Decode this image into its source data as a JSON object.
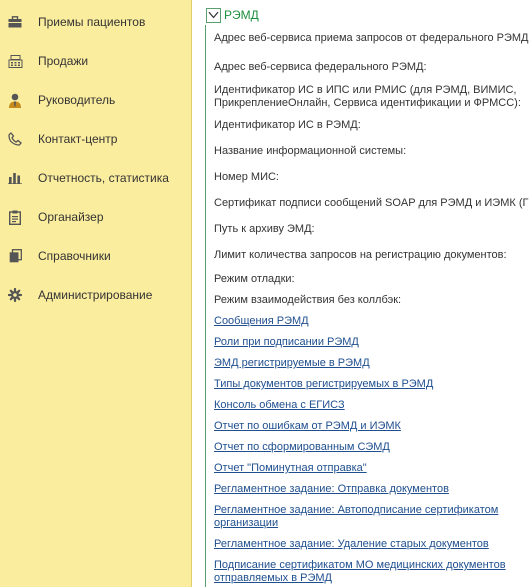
{
  "sidebar": {
    "items": [
      {
        "label": "Приемы пациентов",
        "icon": "briefcase-icon"
      },
      {
        "label": "Продажи",
        "icon": "cash-register-icon"
      },
      {
        "label": "Руководитель",
        "icon": "manager-icon"
      },
      {
        "label": "Контакт-центр",
        "icon": "phone-icon"
      },
      {
        "label": "Отчетность, статистика",
        "icon": "bar-chart-icon"
      },
      {
        "label": "Органайзер",
        "icon": "clipboard-icon"
      },
      {
        "label": "Справочники",
        "icon": "documents-icon"
      },
      {
        "label": "Администрирование",
        "icon": "gear-icon"
      }
    ]
  },
  "main": {
    "group_title": "РЭМД",
    "fields": [
      {
        "label": "Адрес веб-сервиса приема запросов от федерального РЭМД:"
      },
      {
        "label": "Адрес веб-сервиса федерального РЭМД:"
      },
      {
        "label_line1": "Идентификатор ИС в ИПС или РМИС (для РЭМД, ВИМИС,",
        "label_line2": "ПрикреплениеОнлайн, Сервиса идентификации и ФРМСС):"
      },
      {
        "label": "Идентификатор ИС в РЭМД:"
      },
      {
        "label": "Название информационной системы:"
      },
      {
        "label": "Номер МИС:"
      },
      {
        "label": "Сертификат подписи сообщений SOAP для РЭМД и ИЭМК (ГИС"
      },
      {
        "label": "Путь к архиву ЭМД:"
      },
      {
        "label": "Лимит количества запросов на регистрацию документов:"
      },
      {
        "label": "Режим отладки:"
      },
      {
        "label": "Режим взаимодействия без коллбэк:"
      }
    ],
    "links": [
      {
        "label": "Сообщения РЭМД"
      },
      {
        "label": "Роли при подписании РЭМД"
      },
      {
        "label": "ЭМД регистрируемые в РЭМД"
      },
      {
        "label": "Типы документов регистрируемых в РЭМД"
      },
      {
        "label": "Консоль обмена с ЕГИСЗ"
      },
      {
        "label": "Отчет по ошибкам от РЭМД и ИЭМК"
      },
      {
        "label": "Отчет по сформированным СЭМД"
      },
      {
        "label": "Отчет \"Поминутная отправка\""
      },
      {
        "label": "Регламентное задание: Отправка документов"
      },
      {
        "label_line1": "Регламентное задание: Автоподписание сертификатом",
        "label_line2": "организации"
      },
      {
        "label": "Регламентное задание: Удаление старых документов"
      },
      {
        "label_line1": "Подписание сертификатом МО медицинских документов",
        "label_line2": "отправляемых в РЭМД"
      }
    ]
  },
  "colors": {
    "sidebar_bg": "#fbed9e",
    "group_title": "#1c8f3c",
    "link": "#1f4f8f"
  }
}
